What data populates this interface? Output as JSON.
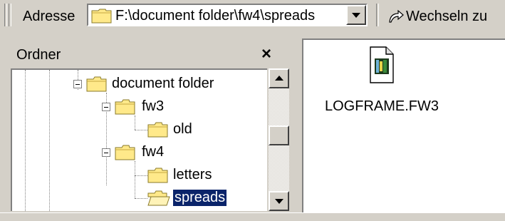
{
  "address_bar": {
    "label": "Adresse",
    "path": "F:\\document folder\\fw4\\spreads",
    "go_label": "Wechseln zu"
  },
  "folder_pane": {
    "title": "Ordner",
    "close_label": "×",
    "tree": [
      {
        "label": "document folder",
        "level": 0,
        "expanded": true
      },
      {
        "label": "fw3",
        "level": 1,
        "expanded": true
      },
      {
        "label": "old",
        "level": 2
      },
      {
        "label": "fw4",
        "level": 1,
        "expanded": true
      },
      {
        "label": "letters",
        "level": 2
      },
      {
        "label": "spreads",
        "level": 2,
        "selected": true,
        "open": true
      }
    ]
  },
  "file_pane": {
    "files": [
      {
        "name": "LOGFRAME.FW3",
        "icon": "document-icon"
      }
    ]
  },
  "colors": {
    "face": "#d4d0c8",
    "selection": "#0a246a",
    "folder": "#ffe98a"
  }
}
